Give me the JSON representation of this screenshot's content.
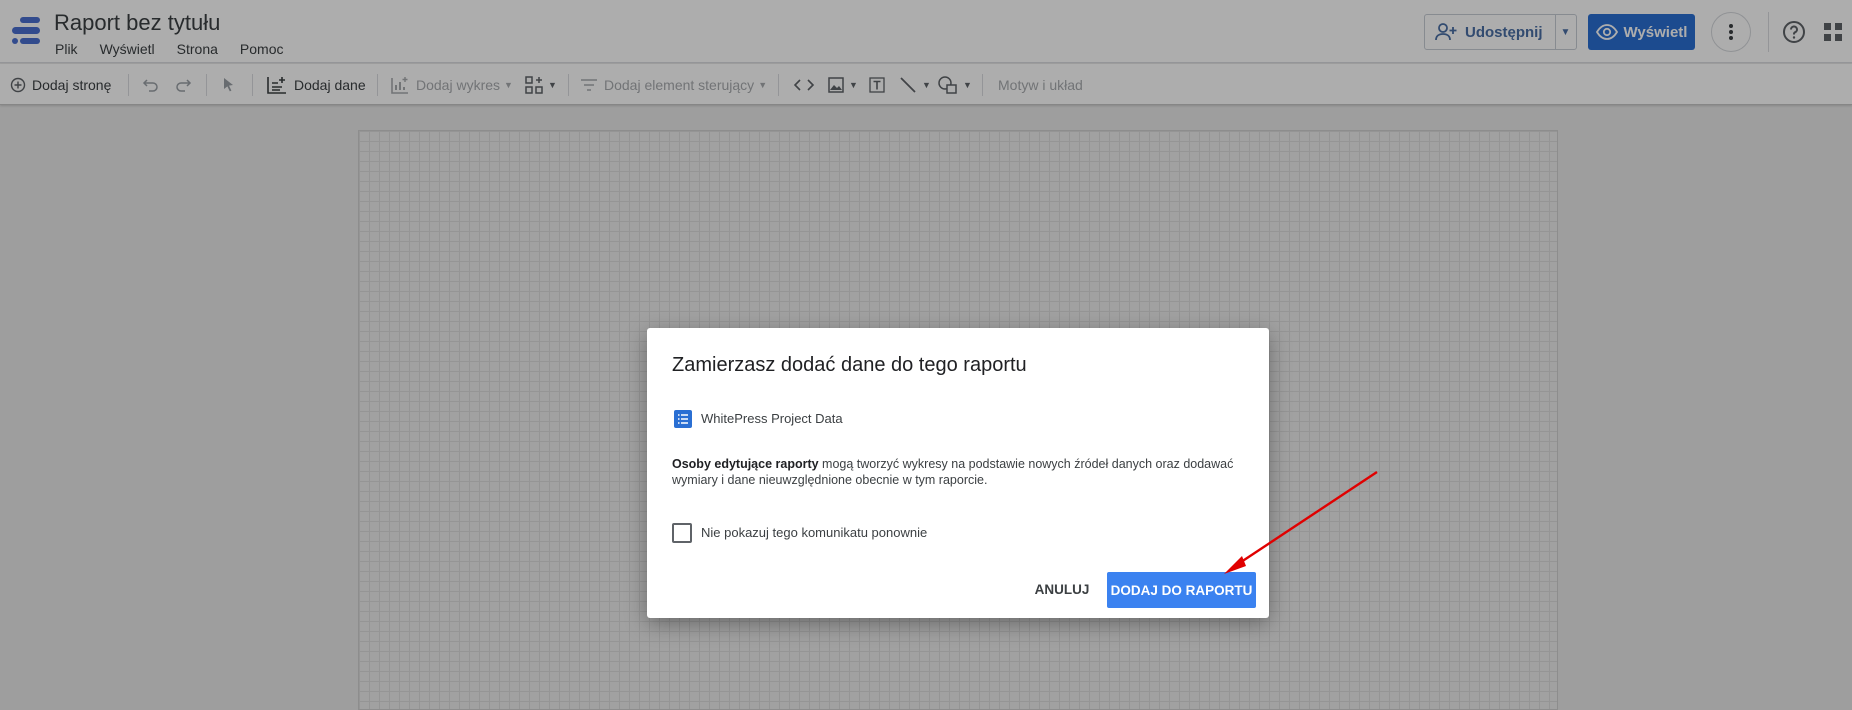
{
  "header": {
    "title": "Raport bez tytułu",
    "menu": [
      "Plik",
      "Wyświetl",
      "Strona",
      "Pomoc"
    ],
    "share_label": "Udostępnij",
    "view_label": "Wyświetl"
  },
  "toolbar": {
    "add_page": "Dodaj stronę",
    "add_data": "Dodaj dane",
    "add_chart": "Dodaj wykres",
    "add_control": "Dodaj element sterujący",
    "theme": "Motyw i układ"
  },
  "dialog": {
    "title": "Zamierzasz dodać dane do tego raportu",
    "source_name": "WhitePress Project Data",
    "desc_bold": "Osoby edytujące raporty",
    "desc_rest": " mogą tworzyć wykresy na podstawie nowych źródeł danych oraz dodawać wymiary i dane nieuwzględnione obecnie w tym raporcie.",
    "checkbox_label": "Nie pokazuj tego komunikatu ponownie",
    "checkbox_checked": false,
    "cancel_label": "ANULUJ",
    "confirm_label": "DODAJ DO RAPORTU"
  },
  "colors": {
    "primary": "#2a6fd3",
    "confirm": "#3b82f0",
    "annotation_arrow": "#e00000"
  }
}
